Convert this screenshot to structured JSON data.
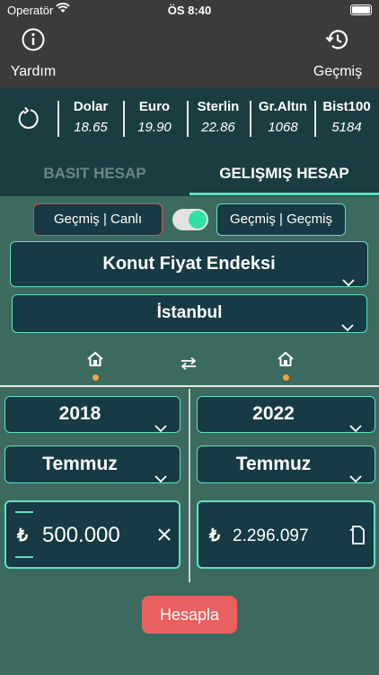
{
  "status": {
    "carrier": "Operatör",
    "time": "ÖS 8:40"
  },
  "nav": {
    "help_label": "Yardım",
    "history_label": "Geçmiş"
  },
  "rates": [
    {
      "name": "Dolar",
      "value": "18.65"
    },
    {
      "name": "Euro",
      "value": "19.90"
    },
    {
      "name": "Sterlin",
      "value": "22.86"
    },
    {
      "name": "Gr.Altın",
      "value": "1068"
    },
    {
      "name": "Bist100",
      "value": "5184"
    }
  ],
  "tabs": {
    "basic": "BASIT HESAP",
    "advanced": "GELIŞMIŞ HESAP",
    "active": "advanced"
  },
  "mode": {
    "left": "Geçmiş | Canlı",
    "right": "Geçmiş | Geçmiş",
    "toggle_on": true
  },
  "selectors": {
    "index": "Konut Fiyat Endeksi",
    "city": "İstanbul"
  },
  "from": {
    "year": "2018",
    "month": "Temmuz",
    "currency_symbol": "₺",
    "amount": "500.000"
  },
  "to": {
    "year": "2022",
    "month": "Temmuz",
    "currency_symbol": "₺",
    "amount": "2.296.097"
  },
  "action": {
    "calculate_label": "Hesapla"
  },
  "colors": {
    "accent": "#5fe0c0",
    "header": "#1b3d42",
    "background": "#3d6a5f",
    "button": "#e86060",
    "indicator": "#f2a33a"
  }
}
